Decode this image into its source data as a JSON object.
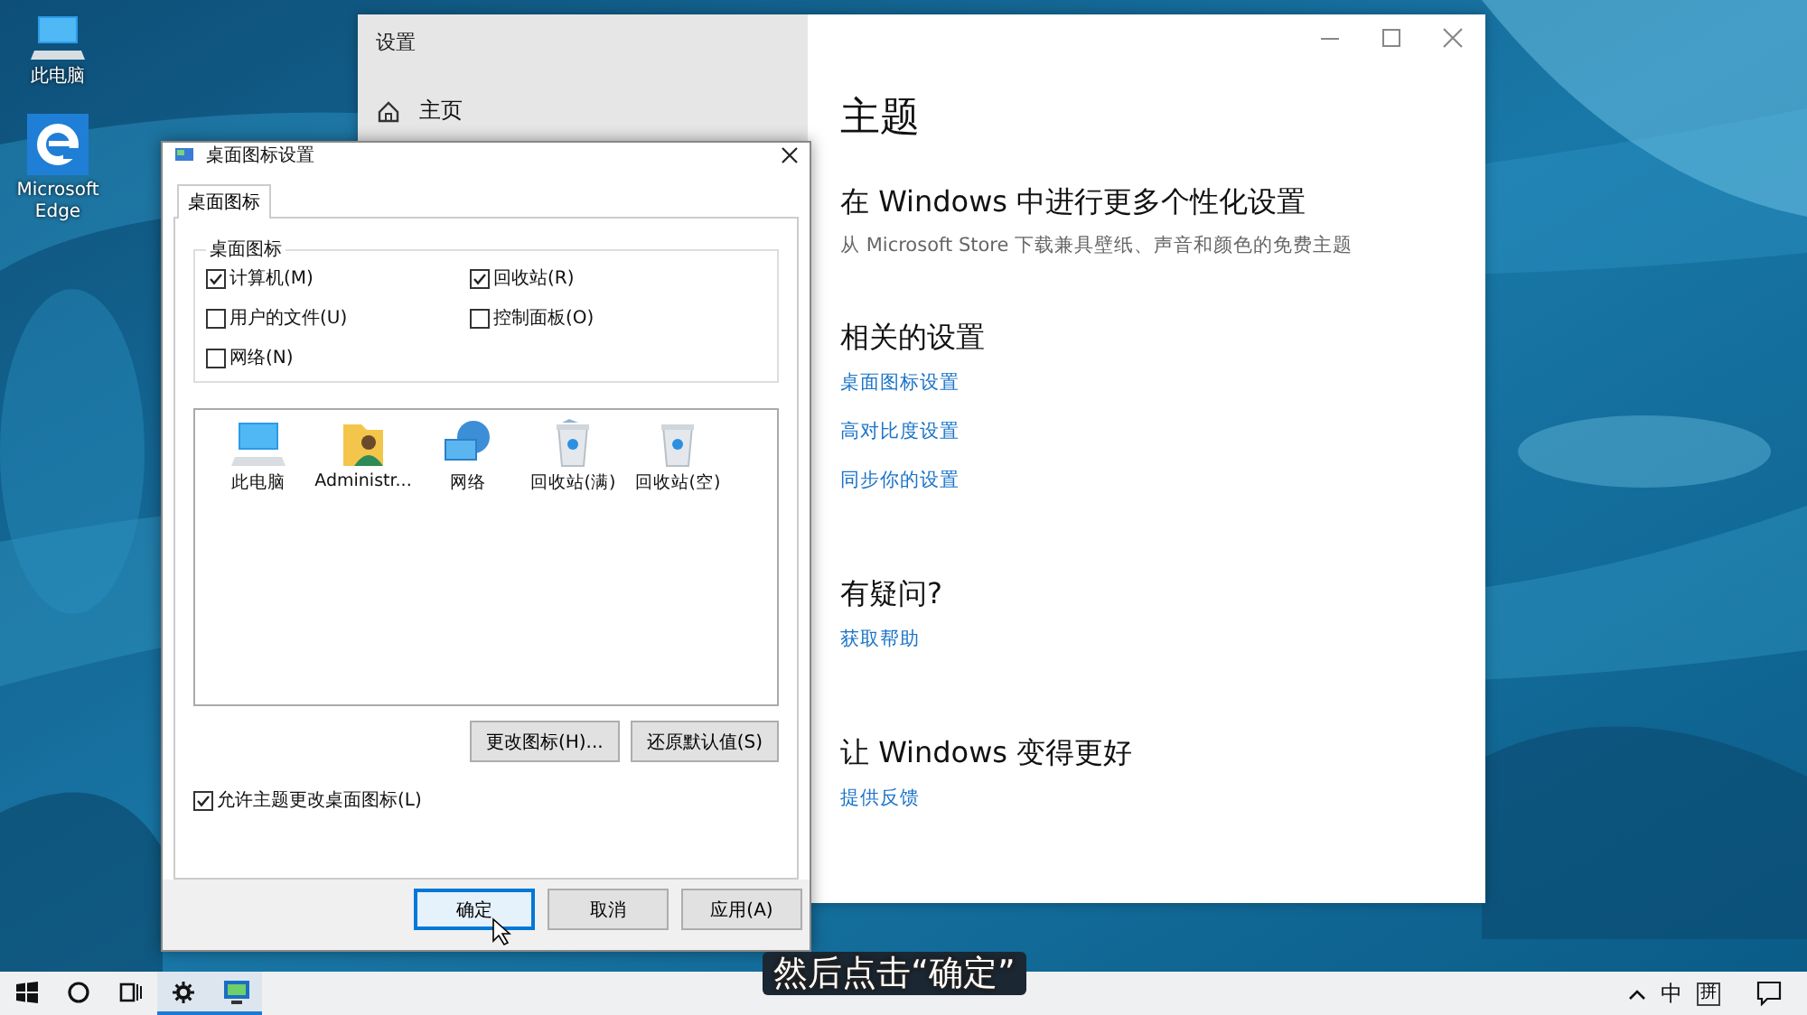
{
  "desktop_icons": [
    {
      "label": "此电脑",
      "kind": "computer"
    },
    {
      "label": "Microsoft Edge",
      "kind": "edge"
    }
  ],
  "settings_window": {
    "title": "设置",
    "home": "主页",
    "heading": "主题",
    "sections": [
      {
        "title": "在 Windows 中进行更多个性化设置",
        "description": "从 Microsoft Store 下载兼具壁纸、声音和颜色的免费主题"
      },
      {
        "title": "相关的设置",
        "links": [
          "桌面图标设置",
          "高对比度设置",
          "同步你的设置"
        ]
      },
      {
        "title": "有疑问?",
        "links": [
          "获取帮助"
        ]
      },
      {
        "title": "让 Windows 变得更好",
        "links": [
          "提供反馈"
        ]
      }
    ]
  },
  "dialog": {
    "title": "桌面图标设置",
    "tabs": [
      {
        "label": "桌面图标",
        "selected": true
      }
    ],
    "group_title": "桌面图标",
    "checkboxes": [
      {
        "label": "计算机(M)",
        "checked": true
      },
      {
        "label": "回收站(R)",
        "checked": true
      },
      {
        "label": "用户的文件(U)",
        "checked": false
      },
      {
        "label": "控制面板(O)",
        "checked": false
      },
      {
        "label": "网络(N)",
        "checked": false
      }
    ],
    "icons": [
      {
        "label": "此电脑",
        "kind": "computer"
      },
      {
        "label": "Administr...",
        "kind": "user-folder"
      },
      {
        "label": "网络",
        "kind": "network"
      },
      {
        "label": "回收站(满)",
        "kind": "bin-full"
      },
      {
        "label": "回收站(空)",
        "kind": "bin-empty"
      }
    ],
    "icon_buttons": [
      "更改图标(H)...",
      "还原默认值(S)"
    ],
    "allow_themes": {
      "label": "允许主题更改桌面图标(L)",
      "checked": true
    },
    "buttons": [
      {
        "label": "确定",
        "focused": true
      },
      {
        "label": "取消",
        "focused": false
      },
      {
        "label": "应用(A)",
        "focused": false
      }
    ]
  },
  "taskbar": {
    "items": [
      {
        "kind": "start",
        "running": false
      },
      {
        "kind": "search",
        "running": false
      },
      {
        "kind": "task-view",
        "running": false
      },
      {
        "kind": "settings",
        "running": true
      },
      {
        "kind": "display",
        "running": true
      }
    ],
    "input_mode": "中",
    "ime": "拼"
  },
  "caption": "然后点击“确定”"
}
